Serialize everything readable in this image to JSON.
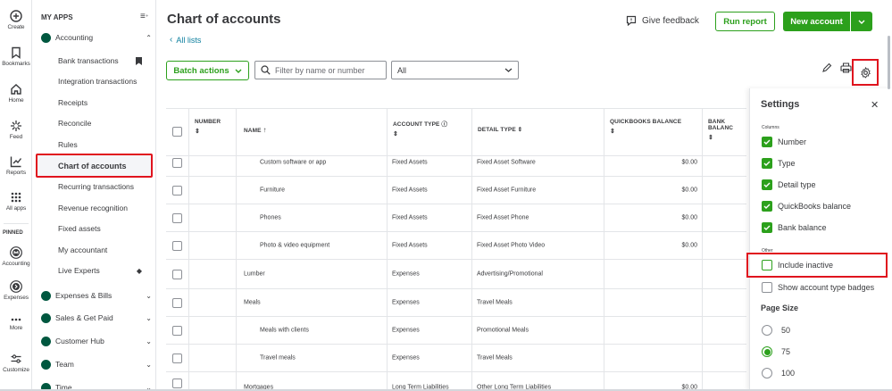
{
  "rail": {
    "items": [
      {
        "label": "Create",
        "icon": "plus-circle-icon"
      },
      {
        "label": "Bookmarks",
        "icon": "bookmark-icon"
      },
      {
        "label": "Home",
        "icon": "home-icon"
      },
      {
        "label": "Feed",
        "icon": "feed-icon"
      },
      {
        "label": "Reports",
        "icon": "reports-icon"
      },
      {
        "label": "All apps",
        "icon": "grid-icon"
      },
      {
        "label": "Accounting",
        "icon": "accounting-icon"
      },
      {
        "label": "Expenses",
        "icon": "expenses-icon"
      },
      {
        "label": "More",
        "icon": "more-icon"
      },
      {
        "label": "Customize",
        "icon": "customize-icon"
      }
    ],
    "pinned_label": "PINNED"
  },
  "sidebar": {
    "header": "MY APPS",
    "sections": [
      {
        "label": "Accounting",
        "expanded": true
      },
      {
        "label": "Expenses & Bills"
      },
      {
        "label": "Sales & Get Paid"
      },
      {
        "label": "Customer Hub"
      },
      {
        "label": "Team"
      },
      {
        "label": "Time"
      }
    ],
    "sub_items": [
      "Bank transactions",
      "Integration transactions",
      "Receipts",
      "Reconcile",
      "Rules",
      "Chart of accounts",
      "Recurring transactions",
      "Revenue recognition",
      "Fixed assets",
      "My accountant",
      "Live Experts"
    ],
    "selected": "Chart of accounts"
  },
  "page": {
    "title": "Chart of accounts",
    "all_lists": "All lists",
    "give_feedback": "Give feedback",
    "run_report": "Run report",
    "new_account": "New account",
    "batch_actions": "Batch actions",
    "search_placeholder": "Filter by name or number",
    "filter_value": "All"
  },
  "table": {
    "headers": {
      "number": "NUMBER",
      "name": "NAME",
      "account_type": "ACCOUNT TYPE",
      "detail_type": "DETAIL TYPE",
      "qb_balance": "QUICKBOOKS BALANCE",
      "bank_balance": "BANK BALANC"
    },
    "rows": [
      {
        "name": "Custom software or app",
        "type": "Fixed Assets",
        "detail": "Fixed Asset Software",
        "balance": "$0.00",
        "indent": true
      },
      {
        "name": "Furniture",
        "type": "Fixed Assets",
        "detail": "Fixed Asset Furniture",
        "balance": "$0.00",
        "indent": true
      },
      {
        "name": "Phones",
        "type": "Fixed Assets",
        "detail": "Fixed Asset Phone",
        "balance": "$0.00",
        "indent": true
      },
      {
        "name": "Photo & video equipment",
        "type": "Fixed Assets",
        "detail": "Fixed Asset Photo Video",
        "balance": "$0.00",
        "indent": true
      },
      {
        "name": "Lumber",
        "type": "Expenses",
        "detail": "Advertising/Promotional",
        "balance": "",
        "indent": false
      },
      {
        "name": "Meals",
        "type": "Expenses",
        "detail": "Travel Meals",
        "balance": "",
        "indent": false
      },
      {
        "name": "Meals with clients",
        "type": "Expenses",
        "detail": "Promotional Meals",
        "balance": "",
        "indent": true
      },
      {
        "name": "Travel meals",
        "type": "Expenses",
        "detail": "Travel Meals",
        "balance": "",
        "indent": true
      },
      {
        "name": "Mortgages",
        "type": "Long Term Liabilities",
        "detail": "Other Long Term Liabilities",
        "balance": "$0.00",
        "indent": false
      }
    ]
  },
  "settings": {
    "title": "Settings",
    "columns_label": "Columns",
    "columns": [
      {
        "label": "Number",
        "checked": true
      },
      {
        "label": "Type",
        "checked": true
      },
      {
        "label": "Detail type",
        "checked": true
      },
      {
        "label": "QuickBooks balance",
        "checked": true
      },
      {
        "label": "Bank balance",
        "checked": true
      }
    ],
    "other_label": "Other",
    "other": [
      {
        "label": "Include inactive",
        "checked": false
      },
      {
        "label": "Show account type badges",
        "checked": false
      }
    ],
    "page_size_label": "Page Size",
    "page_sizes": [
      {
        "label": "50",
        "selected": false
      },
      {
        "label": "75",
        "selected": true
      },
      {
        "label": "100",
        "selected": false
      }
    ]
  },
  "colors": {
    "accent": "#2ca01c",
    "highlight": "#e0141e",
    "link": "#0d7f9e",
    "brand_dark": "#00573f"
  }
}
